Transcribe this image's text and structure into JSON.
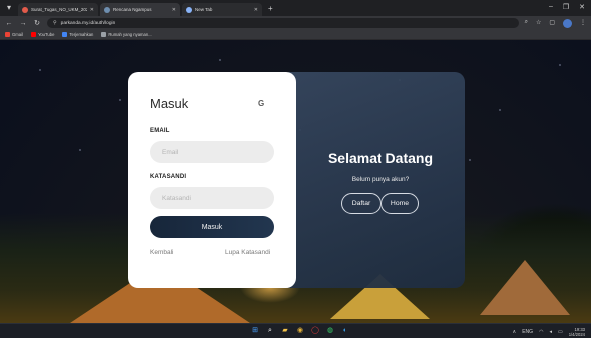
{
  "browser": {
    "tabs": [
      {
        "title": "Surat_Tugas_NO_UKM_2023.pdf",
        "active": false
      },
      {
        "title": "Rencana Ngampus",
        "active": true
      },
      {
        "title": "New Tab",
        "active": false
      }
    ],
    "url": "parkanda.my.id/auth/login",
    "bookmarks": [
      {
        "label": "Gmail",
        "color": "#ea4335"
      },
      {
        "label": "YouTube",
        "color": "#ff0000"
      },
      {
        "label": "Terjemahkan",
        "color": "#4285f4"
      },
      {
        "label": "Rumah yang nyaman...",
        "color": "#9aa0a6"
      }
    ]
  },
  "login": {
    "title": "Masuk",
    "email_label": "EMAIL",
    "email_placeholder": "Email",
    "password_label": "KATASANDI",
    "password_placeholder": "Katasandi",
    "submit_label": "Masuk",
    "back_link": "Kembali",
    "forgot_link": "Lupa Katasandi"
  },
  "welcome": {
    "title": "Selamat Datang",
    "subtitle": "Belum punya akun?",
    "register_label": "Daftar",
    "home_label": "Home"
  },
  "taskbar": {
    "lang": "ENG",
    "time": "19:33",
    "date": "1/4/2024"
  },
  "colors": {
    "accent": "#1e2f45",
    "panel": "#2c3d55"
  }
}
